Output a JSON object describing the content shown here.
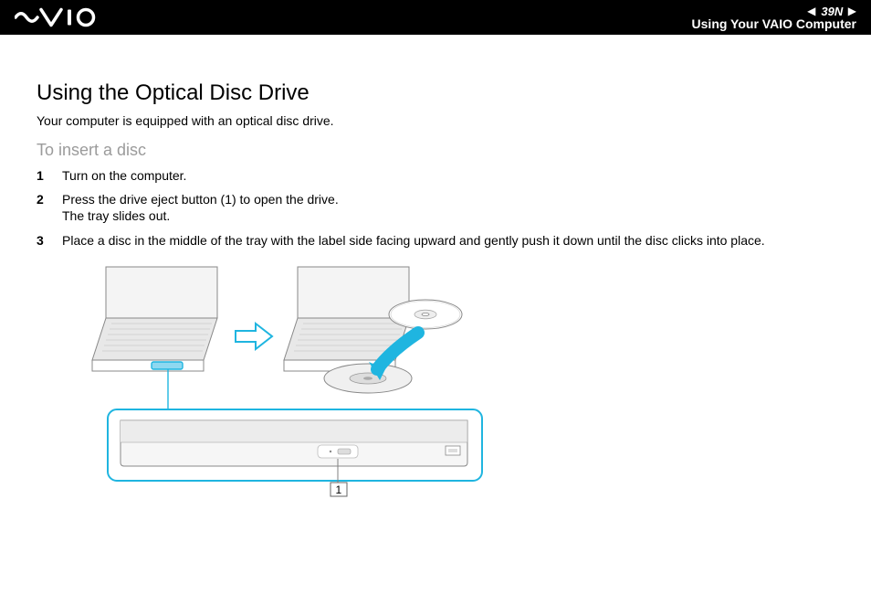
{
  "header": {
    "logo_alt": "VAIO",
    "page_number": "39",
    "page_number_n": "N",
    "section_label": "Using Your VAIO Computer"
  },
  "content": {
    "title": "Using the Optical Disc Drive",
    "intro": "Your computer is equipped with an optical disc drive.",
    "subtitle": "To insert a disc",
    "steps": [
      {
        "num": "1",
        "text": "Turn on the computer."
      },
      {
        "num": "2",
        "text": "Press the drive eject button (1) to open the drive.\nThe tray slides out."
      },
      {
        "num": "3",
        "text": "Place a disc in the middle of the tray with the label side facing upward and gently push it down until the disc clicks into place."
      }
    ],
    "callout_label": "1"
  }
}
